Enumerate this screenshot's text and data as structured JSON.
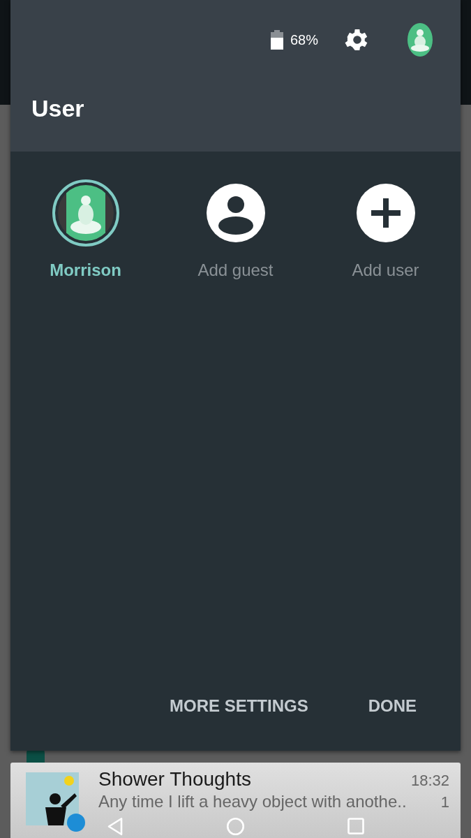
{
  "status": {
    "battery": "68%"
  },
  "header": {
    "title": "User"
  },
  "users": [
    {
      "kind": "user",
      "label": "Morrison",
      "selected": true
    },
    {
      "kind": "guest",
      "label": "Add guest",
      "selected": false
    },
    {
      "kind": "add",
      "label": "Add user",
      "selected": false
    }
  ],
  "buttons": [
    "MORE SETTINGS",
    "DONE"
  ],
  "notification": {
    "title": "Shower Thoughts",
    "text": "Any time I lift a heavy object with anothe..",
    "time": "18:32",
    "count": "1"
  }
}
